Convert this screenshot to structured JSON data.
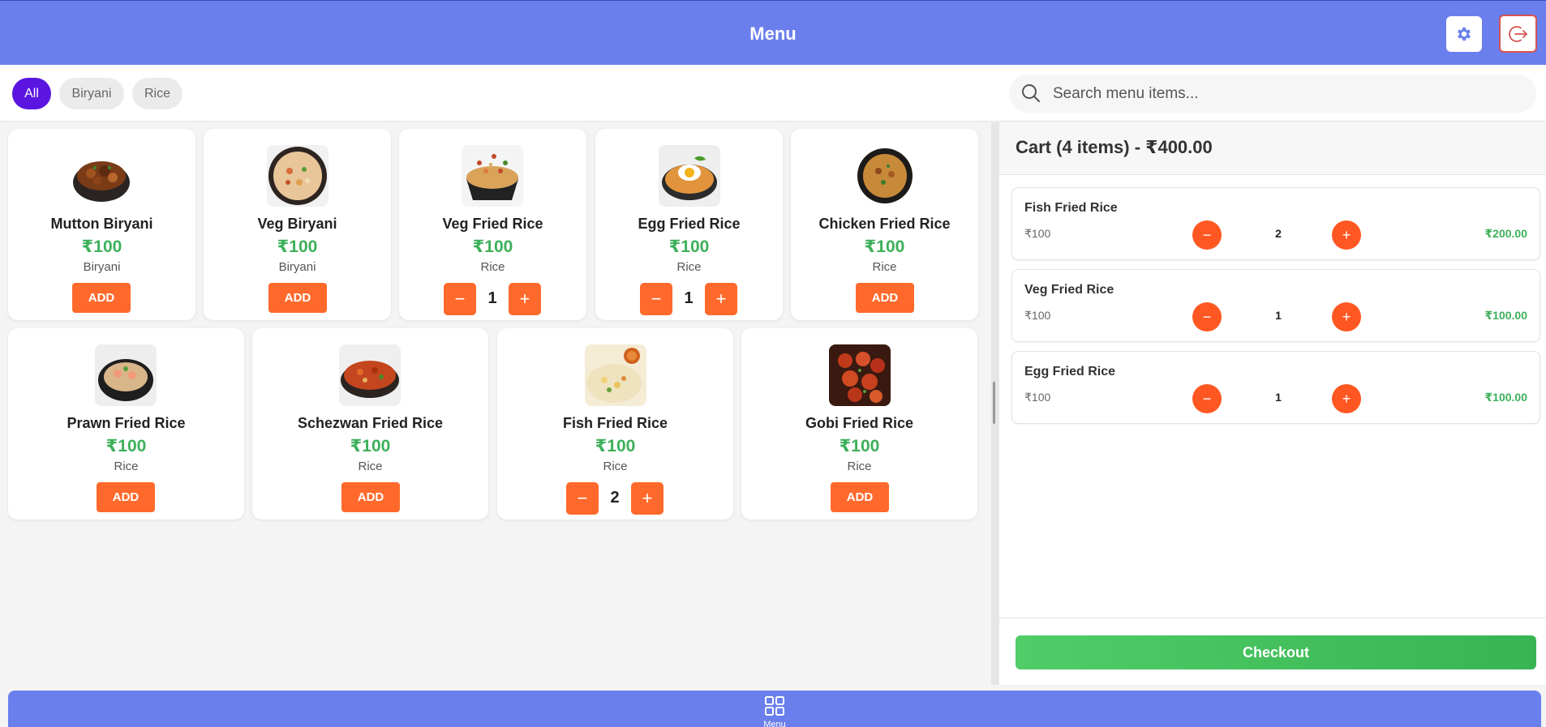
{
  "header": {
    "title": "Menu"
  },
  "filters": {
    "chips": [
      "All",
      "Biryani",
      "Rice"
    ],
    "active": "All"
  },
  "search": {
    "placeholder": "Search menu items..."
  },
  "menu_items": [
    {
      "name": "Mutton Biryani",
      "price": "₹100",
      "category": "Biryani",
      "action": "ADD"
    },
    {
      "name": "Veg Biryani",
      "price": "₹100",
      "category": "Biryani",
      "action": "ADD"
    },
    {
      "name": "Veg Fried Rice",
      "price": "₹100",
      "category": "Rice",
      "quantity": "1"
    },
    {
      "name": "Egg Fried Rice",
      "price": "₹100",
      "category": "Rice",
      "quantity": "1"
    },
    {
      "name": "Chicken Fried Rice",
      "price": "₹100",
      "category": "Rice",
      "action": "ADD"
    },
    {
      "name": "Prawn Fried Rice",
      "price": "₹100",
      "category": "Rice",
      "action": "ADD"
    },
    {
      "name": "Schezwan Fried Rice",
      "price": "₹100",
      "category": "Rice",
      "action": "ADD"
    },
    {
      "name": "Fish Fried Rice",
      "price": "₹100",
      "category": "Rice",
      "quantity": "2"
    },
    {
      "name": "Gobi Fried Rice",
      "price": "₹100",
      "category": "Rice",
      "action": "ADD"
    }
  ],
  "cart": {
    "title": "Cart (4 items) - ₹400.00",
    "items": [
      {
        "name": "Fish Fried Rice",
        "unit_price": "₹100",
        "quantity": "2",
        "total": "₹200.00"
      },
      {
        "name": "Veg Fried Rice",
        "unit_price": "₹100",
        "quantity": "1",
        "total": "₹100.00"
      },
      {
        "name": "Egg Fried Rice",
        "unit_price": "₹100",
        "quantity": "1",
        "total": "₹100.00"
      }
    ],
    "checkout_label": "Checkout"
  },
  "bottom_nav": {
    "items": [
      {
        "label": "Menu",
        "icon": "grid-icon"
      }
    ]
  },
  "colors": {
    "primary": "#6a7fec",
    "accent": "#ff6a2c",
    "price": "#3db05a",
    "active_chip": "#5a16e0",
    "checkout": "#45c25e",
    "logout": "#d9534f"
  },
  "icons": {
    "settings": "gear-icon",
    "logout": "logout-icon",
    "search": "search-icon",
    "minus": "minus-icon",
    "plus": "plus-icon"
  }
}
